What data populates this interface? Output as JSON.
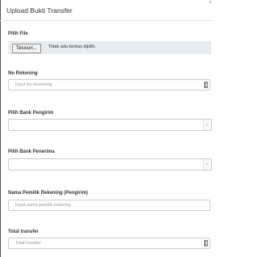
{
  "modal": {
    "title": "Upload Bukti Transfer",
    "close_glyph": "×"
  },
  "file_upload": {
    "label": "Pilih File",
    "button_label": "Telusuri...",
    "status_text": "Tidak ada berkas dipilih."
  },
  "no_rekening": {
    "label": "No Rekening",
    "placeholder": "Input No Rekening",
    "value": ""
  },
  "bank_pengirim": {
    "label": "Pilih Bank Pengirim",
    "selected": "",
    "icon": "chevron-down-icon"
  },
  "bank_penerima": {
    "label": "Pilih Bank Penerima",
    "selected": "",
    "icon": "chevron-down-icon"
  },
  "nama_pemilik": {
    "label": "Nama Pemilik Rekening (Pengirim)",
    "placeholder": "Input nama pemilik rekening",
    "value": ""
  },
  "total_transfer": {
    "label": "Total transfer",
    "placeholder": "Total transfer",
    "value": ""
  }
}
